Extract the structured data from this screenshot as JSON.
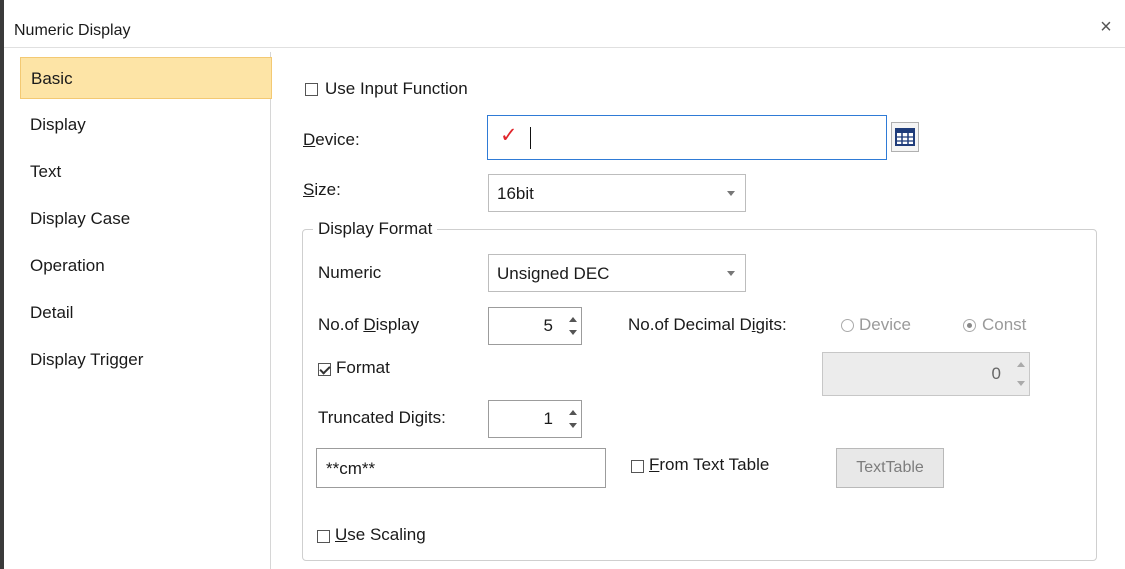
{
  "window": {
    "title": "Numeric Display",
    "close_symbol": "×"
  },
  "sidebar": {
    "items": [
      {
        "label": "Basic",
        "active": true
      },
      {
        "label": "Display"
      },
      {
        "label": "Text"
      },
      {
        "label": "Display Case"
      },
      {
        "label": "Operation"
      },
      {
        "label": "Detail"
      },
      {
        "label": "Display Trigger"
      }
    ]
  },
  "basic": {
    "use_input_function": {
      "label": "Use Input Function",
      "checked": false
    },
    "device": {
      "label_first": "D",
      "label_rest": "evice:",
      "value": "",
      "check_mark": "✓"
    },
    "size": {
      "label_first": "S",
      "label_rest": "ize:",
      "value": "16bit"
    },
    "display_format": {
      "title": "Display Format",
      "numeric": {
        "label": "Numeric",
        "value": "Unsigned DEC"
      },
      "no_of_display": {
        "label_pre": "No.of ",
        "label_u": "D",
        "label_post": "isplay",
        "value": "5"
      },
      "decimal_digits": {
        "label_pre": "No.of Decimal D",
        "label_u": "i",
        "label_post": "gits:",
        "option_device": "Device",
        "option_const": "Const",
        "selected": "Const",
        "value": "0"
      },
      "format": {
        "label": "Format",
        "checked": true
      },
      "truncated_digits": {
        "label": "Truncated Digits:",
        "value": "1"
      },
      "format_text": "**cm**",
      "from_text_table": {
        "label_u": "F",
        "label_rest": "rom Text Table",
        "checked": false
      },
      "text_table_button": "TextTable"
    },
    "use_scaling": {
      "label_u": "U",
      "label_rest": "se Scaling",
      "checked": false
    }
  },
  "colors": {
    "active_tab": "#fde4a6",
    "focus_border": "#2f7bd6",
    "check_mark": "#e0252b"
  }
}
